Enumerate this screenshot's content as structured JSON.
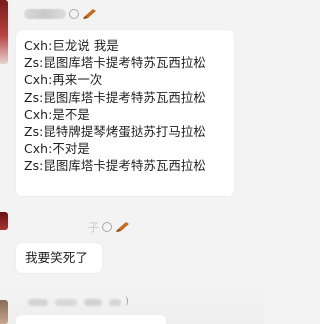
{
  "messages": [
    {
      "lines": [
        "Cxh:巨龙说 我是",
        "Zs:昆图库塔卡提考特苏瓦西拉松",
        "Cxh:再来一次",
        "Zs:昆图库塔卡提考特苏瓦西拉松",
        "Cxh:是不是",
        "Zs:昆特牌提琴烤蛋挞苏打马拉松",
        "Cxh:不对是",
        "Zs:昆图库塔卡提考特苏瓦西拉松"
      ]
    },
    {
      "sender_fragment": "子",
      "text": "我要笑死了"
    },
    {
      "sender_fragment": ")"
    }
  ],
  "icons": {
    "pen": "pen-icon",
    "badge": "badge-icon"
  },
  "colors": {
    "background": "#f3f3f3",
    "bubble": "#ffffff",
    "pen": "#c76b1a"
  }
}
